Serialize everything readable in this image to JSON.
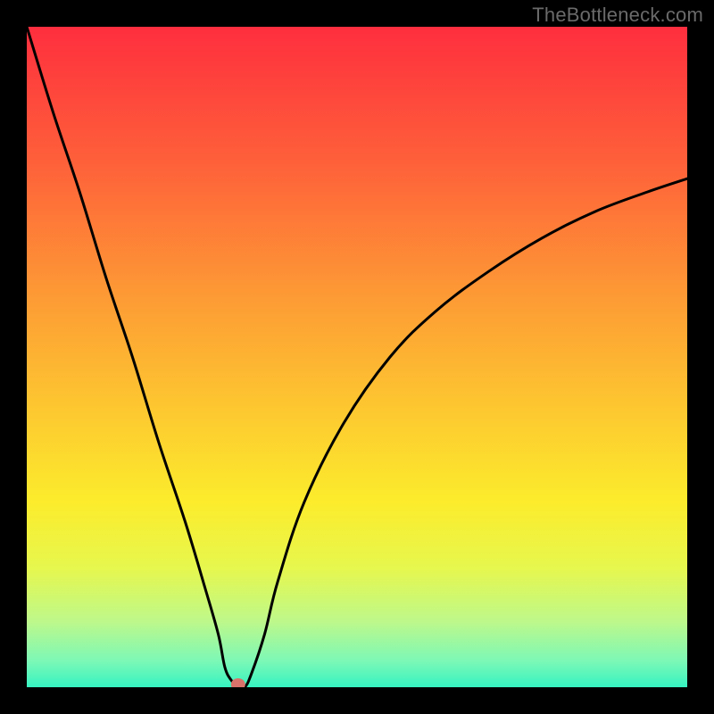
{
  "attribution": "TheBottleneck.com",
  "chart_data": {
    "type": "line",
    "title": "",
    "xlabel": "",
    "ylabel": "",
    "xlim": [
      0,
      100
    ],
    "ylim": [
      0,
      100
    ],
    "grid": false,
    "legend": false,
    "marker": {
      "x": 32,
      "y": 0
    },
    "background_gradient": {
      "direction": "vertical",
      "stops": [
        {
          "at": 0.0,
          "color": "#fe2e3e"
        },
        {
          "at": 0.2,
          "color": "#fe5f3a"
        },
        {
          "at": 0.4,
          "color": "#fd9835"
        },
        {
          "at": 0.58,
          "color": "#fdc830"
        },
        {
          "at": 0.72,
          "color": "#fcec2c"
        },
        {
          "at": 0.82,
          "color": "#e6f74e"
        },
        {
          "at": 0.9,
          "color": "#bef88a"
        },
        {
          "at": 0.96,
          "color": "#7df8b6"
        },
        {
          "at": 1.0,
          "color": "#36f3c1"
        }
      ]
    },
    "series": [
      {
        "name": "bottleneck-curve",
        "x": [
          0,
          4,
          8,
          12,
          16,
          20,
          24,
          27,
          29,
          30,
          31,
          32,
          33,
          34,
          36,
          38,
          42,
          48,
          55,
          62,
          70,
          78,
          86,
          94,
          100
        ],
        "y": [
          100,
          87,
          75,
          62,
          50,
          37,
          25,
          15,
          8,
          3,
          1,
          0,
          0,
          2,
          8,
          16,
          28,
          40,
          50,
          57,
          63,
          68,
          72,
          75,
          77
        ]
      }
    ]
  }
}
